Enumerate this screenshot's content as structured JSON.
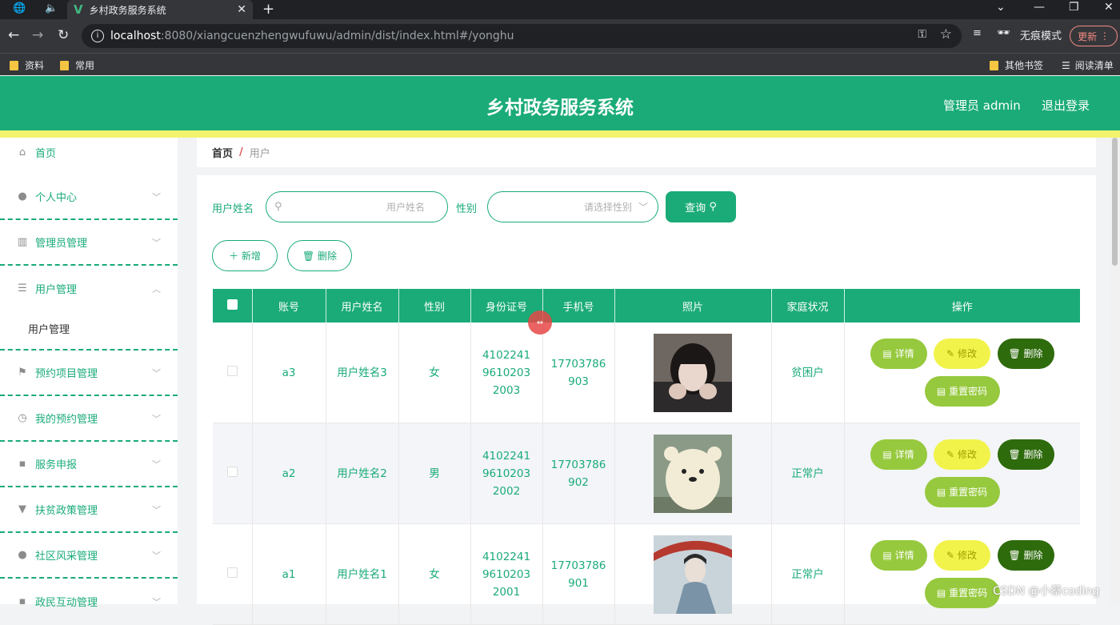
{
  "browser": {
    "tab_title": "乡村政务服务系统",
    "url_host": "localhost",
    "url_path": ":8080/xiangcuenzhengwufuwu/admin/dist/index.html#/yonghu",
    "incognito_label": "无痕模式",
    "update_label": "更新",
    "bookmarks": [
      "资料",
      "常用"
    ],
    "other_bookmarks": "其他书签",
    "reading_list": "阅读清单"
  },
  "header": {
    "title": "乡村政务服务系统",
    "user": "管理员 admin",
    "logout": "退出登录"
  },
  "sidebar": {
    "items": [
      {
        "label": "首页",
        "icon": "home-icon"
      },
      {
        "label": "个人中心",
        "icon": "user-icon"
      },
      {
        "label": "管理员管理",
        "icon": "bars-icon"
      },
      {
        "label": "用户管理",
        "icon": "list-icon"
      },
      {
        "label": "预约项目管理",
        "icon": "flag-icon"
      },
      {
        "label": "我的预约管理",
        "icon": "clock-icon"
      },
      {
        "label": "服务申报",
        "icon": "chat-icon"
      },
      {
        "label": "扶贫政策管理",
        "icon": "sign-icon"
      },
      {
        "label": "社区风采管理",
        "icon": "pin-icon"
      },
      {
        "label": "政民互动管理",
        "icon": "comment-icon"
      }
    ],
    "submenu_label": "用户管理"
  },
  "breadcrumb": {
    "home": "首页",
    "current": "用户"
  },
  "search": {
    "name_label": "用户姓名",
    "name_placeholder": "用户姓名",
    "gender_label": "性别",
    "gender_placeholder": "请选择性别",
    "query_label": "查询"
  },
  "actions": {
    "add_label": "新增",
    "delete_label": "删除"
  },
  "table": {
    "columns": [
      "账号",
      "用户姓名",
      "性别",
      "身份证号",
      "手机号",
      "照片",
      "家庭状况",
      "操作"
    ],
    "rows": [
      {
        "account": "a3",
        "name": "用户姓名3",
        "gender": "女",
        "id_number": "410224196102032003",
        "phone": "17703786903",
        "family": "贫困户"
      },
      {
        "account": "a2",
        "name": "用户姓名2",
        "gender": "男",
        "id_number": "410224196102032002",
        "phone": "17703786902",
        "family": "正常户"
      },
      {
        "account": "a1",
        "name": "用户姓名1",
        "gender": "女",
        "id_number": "410224196102032001",
        "phone": "17703786901",
        "family": "正常户"
      }
    ],
    "op_labels": {
      "detail": "详情",
      "edit": "修改",
      "delete": "删除",
      "reset": "重置密码"
    }
  },
  "watermark": "CSDN @小蔡coding",
  "colors": {
    "primary": "#1aab78",
    "accent_yellow": "#f2f36c",
    "dark_green": "#2e6b0c",
    "lime": "#96c93d"
  }
}
